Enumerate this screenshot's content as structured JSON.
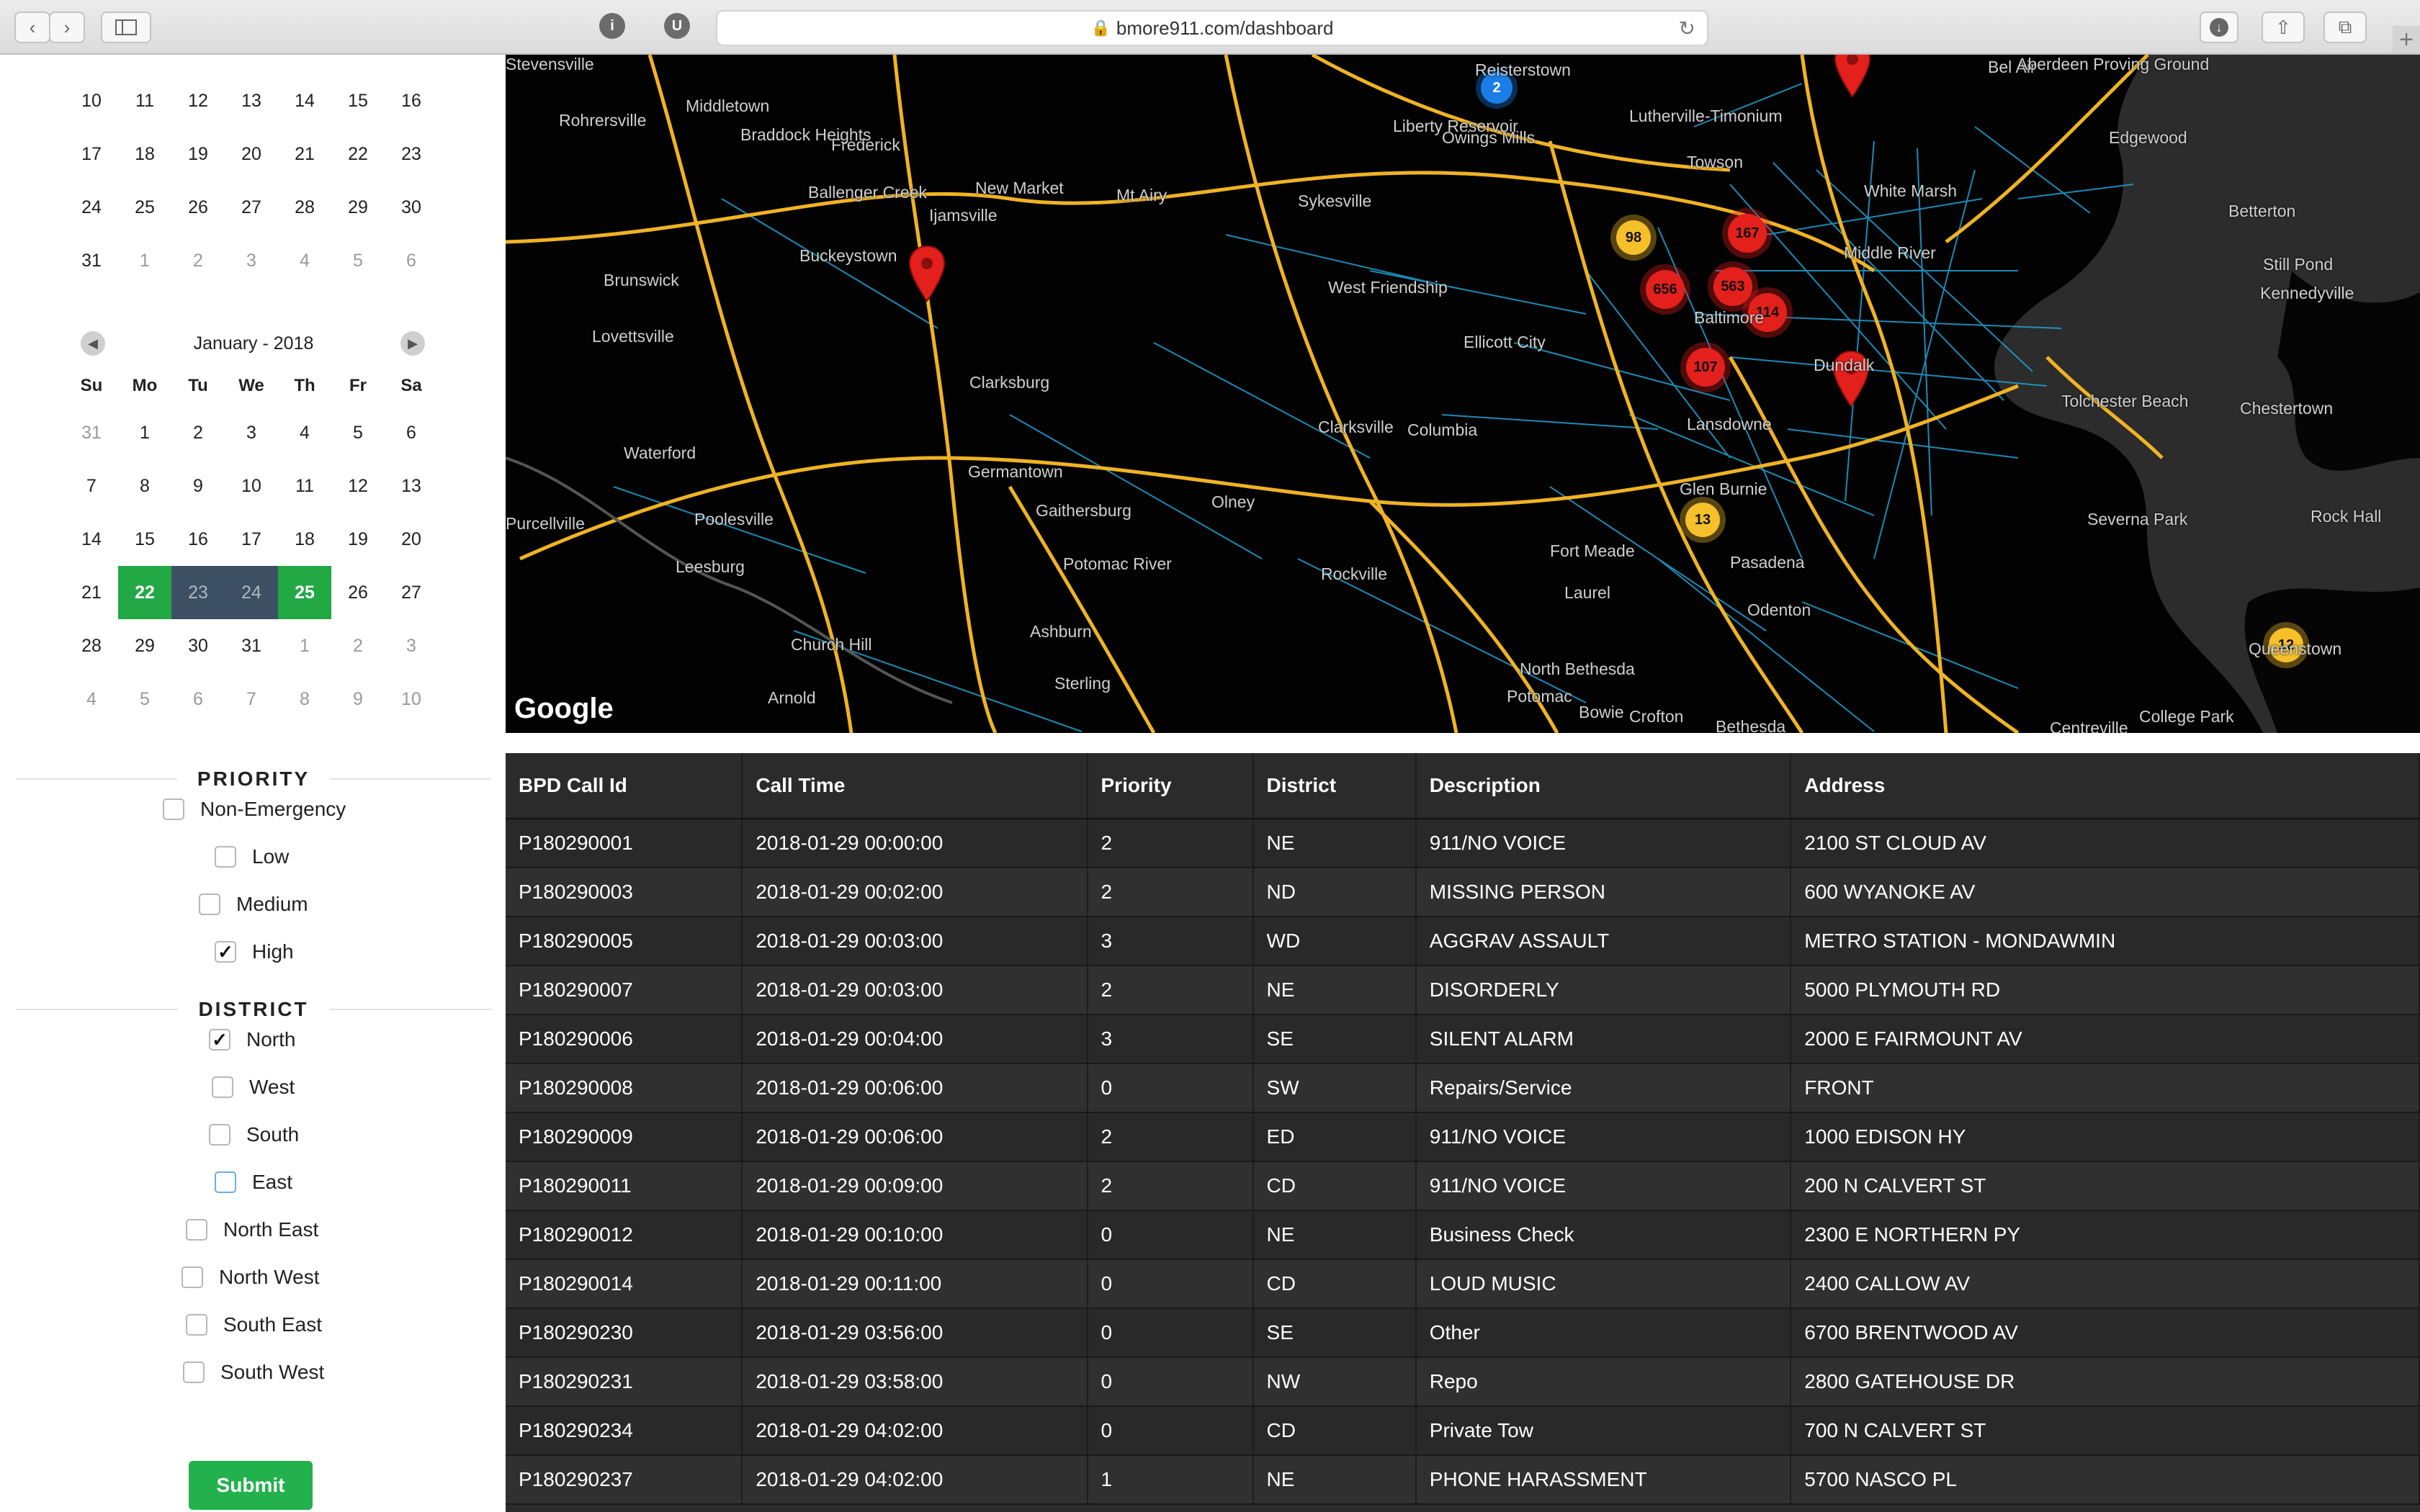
{
  "browser": {
    "url": "bmore911.com/dashboard",
    "back_icon": "chevron-left-icon",
    "forward_icon": "chevron-right-icon",
    "sidebar_icon": "sidebar-icon",
    "ext1_label": "i",
    "ext2_label": "U"
  },
  "calendar_prev": {
    "rows": [
      [
        "10",
        "11",
        "12",
        "13",
        "14",
        "15",
        "16"
      ],
      [
        "17",
        "18",
        "19",
        "20",
        "21",
        "22",
        "23"
      ],
      [
        "24",
        "25",
        "26",
        "27",
        "28",
        "29",
        "30"
      ],
      [
        "31",
        "1",
        "2",
        "3",
        "4",
        "5",
        "6"
      ]
    ]
  },
  "calendar": {
    "title": "January - 2018",
    "weekdays": [
      "Su",
      "Mo",
      "Tu",
      "We",
      "Th",
      "Fr",
      "Sa"
    ],
    "rows": [
      [
        "31",
        "1",
        "2",
        "3",
        "4",
        "5",
        "6"
      ],
      [
        "7",
        "8",
        "9",
        "10",
        "11",
        "12",
        "13"
      ],
      [
        "14",
        "15",
        "16",
        "17",
        "18",
        "19",
        "20"
      ],
      [
        "21",
        "22",
        "23",
        "24",
        "25",
        "26",
        "27"
      ],
      [
        "28",
        "29",
        "30",
        "31",
        "1",
        "2",
        "3"
      ],
      [
        "4",
        "5",
        "6",
        "7",
        "8",
        "9",
        "10"
      ]
    ],
    "selected_start": "22",
    "selected_end": "25",
    "colors": {
      "selected": "#22a845",
      "range": "#3d4f63"
    }
  },
  "priority": {
    "title": "PRIORITY",
    "options": [
      {
        "label": "Non-Emergency",
        "checked": false
      },
      {
        "label": "Low",
        "checked": false
      },
      {
        "label": "Medium",
        "checked": false
      },
      {
        "label": "High",
        "checked": true
      }
    ]
  },
  "district": {
    "title": "DISTRICT",
    "options": [
      {
        "label": "North",
        "checked": true
      },
      {
        "label": "West",
        "checked": false
      },
      {
        "label": "South",
        "checked": false
      },
      {
        "label": "East",
        "checked": false
      },
      {
        "label": "North East",
        "checked": false
      },
      {
        "label": "North West",
        "checked": false
      },
      {
        "label": "South East",
        "checked": false
      },
      {
        "label": "South West",
        "checked": false
      }
    ]
  },
  "submit_label": "Submit",
  "map": {
    "logo": "Google",
    "clusters": [
      {
        "count": "2",
        "color": "blue"
      },
      {
        "count": "98",
        "color": "yellow"
      },
      {
        "count": "167",
        "color": "red"
      },
      {
        "count": "656",
        "color": "red"
      },
      {
        "count": "563",
        "color": "red"
      },
      {
        "count": "114",
        "color": "red"
      },
      {
        "count": "107",
        "color": "red"
      },
      {
        "count": "13",
        "color": "yellow"
      },
      {
        "count": "12",
        "color": "yellow"
      }
    ],
    "places": [
      "Reisterstown",
      "Middletown",
      "Frederick",
      "Braddock Heights",
      "Rohrersville",
      "Owings Mills",
      "Liberty Reservoir",
      "Lutherville-Timonium",
      "Towson",
      "Bel Air",
      "Aberdeen Proving Ground",
      "Edgewood",
      "White Marsh",
      "Middle River",
      "Betterton",
      "Still Pond",
      "Kennedyville",
      "Brunswick",
      "Ballenger Creek",
      "Buckeystown",
      "New Market",
      "Ijamsville",
      "Mt Airy",
      "Sykesville",
      "West Friendship",
      "Ellicott City",
      "Baltimore",
      "Dundalk",
      "Lovettsville",
      "Clarksburg",
      "Clarksville",
      "Columbia",
      "Tolchester Beach",
      "Chestertown",
      "Waterford",
      "Germantown",
      "Gaithersburg",
      "Olney",
      "Lansdowne",
      "Glen Burnie",
      "Fort Meade",
      "Pasadena",
      "Purcellville",
      "Poolesville",
      "Leesburg",
      "Potomac River",
      "Rockville",
      "Laurel",
      "Odenton",
      "Severna Park",
      "Rock Hall",
      "Church Hill",
      "Ashburn",
      "North Bethesda",
      "Arnold",
      "Sterling",
      "Potomac",
      "Bowie",
      "Crofton",
      "Bethesda",
      "College Park",
      "Queenstown",
      "Centreville",
      "Stevensville"
    ]
  },
  "table": {
    "columns": [
      "BPD Call Id",
      "Call Time",
      "Priority",
      "District",
      "Description",
      "Address"
    ],
    "rows": [
      [
        "P180290001",
        "2018-01-29 00:00:00",
        "2",
        "NE",
        "911/NO VOICE",
        "2100 ST CLOUD AV"
      ],
      [
        "P180290003",
        "2018-01-29 00:02:00",
        "2",
        "ND",
        "MISSING PERSON",
        "600 WYANOKE AV"
      ],
      [
        "P180290005",
        "2018-01-29 00:03:00",
        "3",
        "WD",
        "AGGRAV ASSAULT",
        "METRO STATION - MONDAWMIN"
      ],
      [
        "P180290007",
        "2018-01-29 00:03:00",
        "2",
        "NE",
        "DISORDERLY",
        "5000 PLYMOUTH RD"
      ],
      [
        "P180290006",
        "2018-01-29 00:04:00",
        "3",
        "SE",
        "SILENT ALARM",
        "2000 E FAIRMOUNT AV"
      ],
      [
        "P180290008",
        "2018-01-29 00:06:00",
        "0",
        "SW",
        "Repairs/Service",
        "FRONT"
      ],
      [
        "P180290009",
        "2018-01-29 00:06:00",
        "2",
        "ED",
        "911/NO VOICE",
        "1000 EDISON HY"
      ],
      [
        "P180290011",
        "2018-01-29 00:09:00",
        "2",
        "CD",
        "911/NO VOICE",
        "200 N CALVERT ST"
      ],
      [
        "P180290012",
        "2018-01-29 00:10:00",
        "0",
        "NE",
        "Business Check",
        "2300 E NORTHERN PY"
      ],
      [
        "P180290014",
        "2018-01-29 00:11:00",
        "0",
        "CD",
        "LOUD MUSIC",
        "2400 CALLOW AV"
      ],
      [
        "P180290230",
        "2018-01-29 03:56:00",
        "0",
        "SE",
        "Other",
        "6700 BRENTWOOD AV"
      ],
      [
        "P180290231",
        "2018-01-29 03:58:00",
        "0",
        "NW",
        "Repo",
        "2800 GATEHOUSE DR"
      ],
      [
        "P180290234",
        "2018-01-29 04:02:00",
        "0",
        "CD",
        "Private Tow",
        "700 N CALVERT ST"
      ],
      [
        "P180290237",
        "2018-01-29 04:02:00",
        "1",
        "NE",
        "PHONE HARASSMENT",
        "5700 NASCO PL"
      ]
    ]
  }
}
